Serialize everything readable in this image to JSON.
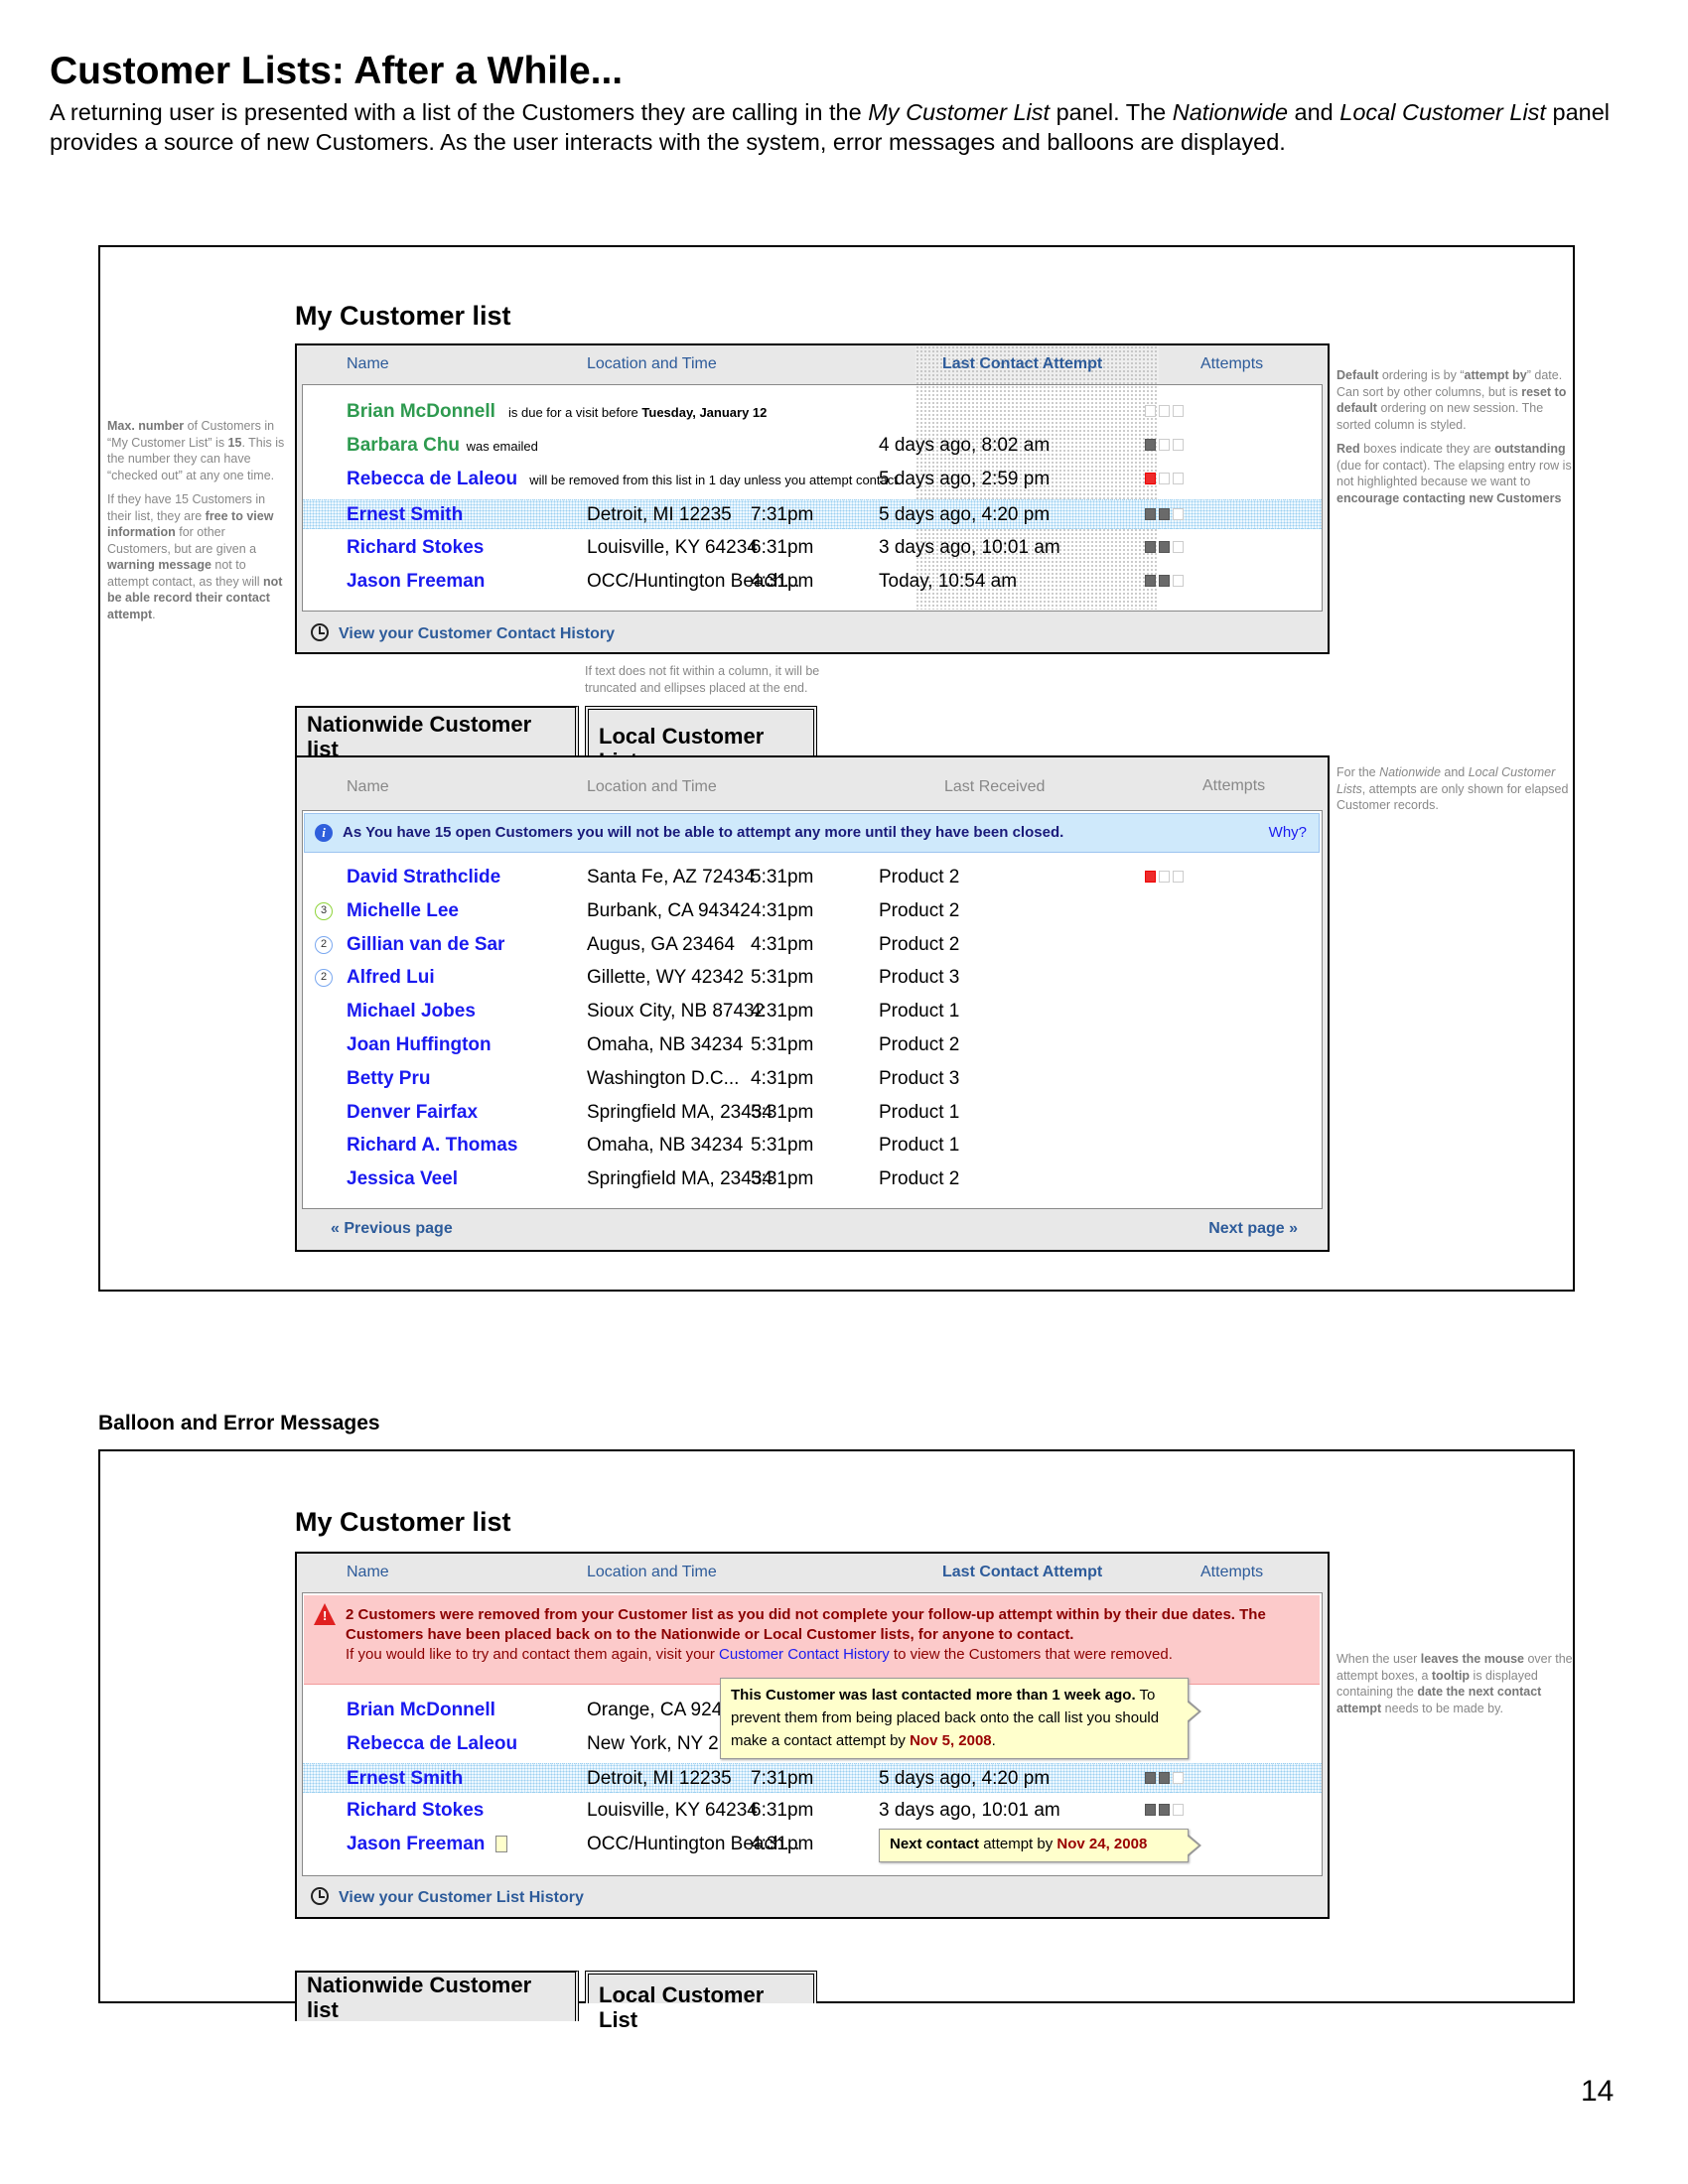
{
  "page": {
    "title": "Customer Lists: After a While...",
    "description_html": "A returning user is presented with a list of the Customers they are calling in the <i>My Customer List</i> panel. The <i>Nationwide</i> and <i>Local Customer List</i> panel provides a source of new Customers. As the user interacts with the system, error messages and balloons are displayed.",
    "section2_title": "Balloon and Error Messages",
    "page_number": "14"
  },
  "colors": {
    "link_blue": "#1a1af0",
    "header_blue": "#2d5b9a",
    "green": "#2e9a4f",
    "red_box": "#ee2b2b",
    "done_box": "#6a6a6a",
    "info_bg": "#cfe9fb",
    "error_bg": "#fccaca",
    "tooltip_bg": "#ffffcc"
  },
  "my_list": {
    "heading": "My Customer list",
    "columns": {
      "name": "Name",
      "location": "Location and Time",
      "last": "Last Contact Attempt",
      "attempts": "Attempts"
    },
    "rows": [
      {
        "name": "Brian McDonnell",
        "style": "green",
        "message_html": "is due for a visit before <b>Tuesday, January 12</b>",
        "attempts": [
          "empty",
          "empty",
          "empty"
        ]
      },
      {
        "name": "Barbara Chu",
        "style": "green",
        "message_html": "was emailed",
        "last": "4 days ago, 8:02 am",
        "attempts": [
          "done",
          "empty",
          "empty"
        ]
      },
      {
        "name": "Rebecca de Laleou",
        "style": "blue",
        "message_html": "will be removed from this list in 1 day unless you attempt contact",
        "last": "5 days ago, 2:59 pm",
        "attempts": [
          "due",
          "empty",
          "empty"
        ]
      },
      {
        "name": "Ernest Smith",
        "style": "blue",
        "highlight": true,
        "location": "Detroit, MI 12235",
        "time": "7:31pm",
        "last": "5 days ago, 4:20 pm",
        "attempts": [
          "done",
          "done",
          "empty"
        ]
      },
      {
        "name": "Richard Stokes",
        "style": "blue",
        "location": "Louisville, KY 64234",
        "time": "6:31pm",
        "last": "3 days ago, 10:01 am",
        "attempts": [
          "done",
          "done",
          "empty"
        ]
      },
      {
        "name": "Jason Freeman",
        "style": "blue",
        "location": "OCC/Huntington Beach...",
        "time": "4:31pm",
        "last": "Today, 10:54 am",
        "attempts": [
          "done",
          "done",
          "empty"
        ]
      }
    ],
    "footer_link": "View your Customer Contact History",
    "footer_icon": "clock-icon"
  },
  "notes": {
    "left_html": "<p><b>Max. number</b> of Customers in “My Customer List” is <b>15</b>. This is the number they can have “checked out” at any one time.</p><p style='margin-top:8px'>If they have 15 Customers in their list, they are <b>free to view information</b> for other Customers, but are given a <b>warning message</b> not to attempt contact, as they will <b>not be able record their contact attempt</b>.</p>",
    "right1_html": "<p><b>Default</b> ordering is by “<b>attempt by</b>” date. Can sort by other columns, but is <b>reset to default</b> ordering on new session. The sorted column is styled.</p><p style='margin-top:8px'><b>Red</b> boxes indicate they are <b>outstanding</b> (due for contact). The elapsing entry row is not highlighted because we want to <b>encourage contacting new Customers</b></p>",
    "truncate": "If text does not fit within a column, it will be truncated and ellipses placed at the end.",
    "right2_html": "For the <i>Nationwide</i> and <i>Local Customer Lists</i>, attempts are only shown for elapsed Customer records.",
    "right3_html": "When the user <b>leaves the mouse</b> over the attempt boxes, a <b>tooltip</b> is displayed containing the <b>date the next contact attempt</b> needs to be made by."
  },
  "tabs": {
    "nationwide": "Nationwide Customer list",
    "local": "Local Customer List"
  },
  "nationwide": {
    "columns": {
      "name": "Name",
      "location": "Location and Time",
      "last": "Last Received",
      "attempts": "Attempts"
    },
    "info_message": "As You have 15 open Customers you will not be able to attempt any more until they have been closed.",
    "info_link": "Why?",
    "info_icon": "info-icon",
    "rows": [
      {
        "name": "David Strathclide",
        "location": "Santa Fe, AZ 72434",
        "time": "5:31pm",
        "product": "Product 2",
        "attempts": [
          "due",
          "empty",
          "empty"
        ]
      },
      {
        "name": "Michelle Lee",
        "badge": "3",
        "badge_style": "green",
        "location": "Burbank, CA 94342",
        "time": "4:31pm",
        "product": "Product 2"
      },
      {
        "name": "Gillian van de Sar",
        "badge": "2",
        "location": "Augus, GA 23464",
        "time": "4:31pm",
        "product": "Product 2"
      },
      {
        "name": "Alfred Lui",
        "badge": "2",
        "location": "Gillette, WY 42342",
        "time": "5:31pm",
        "product": "Product 3"
      },
      {
        "name": "Michael Jobes",
        "location": "Sioux City, NB 87432",
        "time": "4:31pm",
        "product": "Product 1"
      },
      {
        "name": "Joan Huffington",
        "location": "Omaha, NB 34234",
        "time": "5:31pm",
        "product": "Product 2"
      },
      {
        "name": "Betty Pru",
        "location": "Washington D.C...",
        "time": "4:31pm",
        "product": "Product 3"
      },
      {
        "name": "Denver Fairfax",
        "location": "Springfield MA, 23434",
        "time": "5:31pm",
        "product": "Product 1"
      },
      {
        "name": "Richard A. Thomas",
        "location": "Omaha, NB 34234",
        "time": "5:31pm",
        "product": "Product 1"
      },
      {
        "name": "Jessica Veel",
        "location": "Springfield MA, 23434",
        "time": "5:31pm",
        "product": "Product 2"
      }
    ],
    "prev": "« Previous page",
    "next": "Next page »"
  },
  "my_list_2": {
    "heading": "My Customer list",
    "columns": {
      "name": "Name",
      "location": "Location and Time",
      "last": "Last Contact Attempt",
      "attempts": "Attempts"
    },
    "error_icon": "warning-icon",
    "error_bold": "2 Customers were removed from your Customer list as you did not complete your follow-up attempt within by their due dates. The Customers have been placed back on to the Nationwide or Local Customer lists, for anyone to contact.",
    "error_pre": "If you would like to try and contact them again, visit your ",
    "error_link": "Customer Contact History",
    "error_post": " to view  the Customers that were removed.",
    "rows": [
      {
        "name": "Brian McDonnell",
        "location": "Orange, CA 924",
        "attempts": [
          "due",
          "empty",
          "empty"
        ]
      },
      {
        "name": "Rebecca de Laleou",
        "location": "New York, NY 2",
        "attempts": [
          "done",
          "empty",
          "empty"
        ]
      },
      {
        "name": "Ernest Smith",
        "highlight": true,
        "location": "Detroit, MI 12235",
        "time": "7:31pm",
        "last": "5 days ago, 4:20 pm",
        "attempts": [
          "done",
          "done",
          "empty"
        ]
      },
      {
        "name": "Richard Stokes",
        "location": "Louisville, KY 64234",
        "time": "6:31pm",
        "last": "3 days ago, 10:01 am",
        "attempts": [
          "done",
          "done",
          "empty"
        ]
      },
      {
        "name": "Jason Freeman",
        "note_icon": "note-icon",
        "location": "OCC/Huntington Beach...",
        "time": "4:31pm",
        "attempts": [
          "done",
          "done",
          "empty"
        ]
      }
    ],
    "tooltip1": {
      "bold": "This Customer was last contacted more than 1 week ago.",
      "text": " To prevent them from being placed back onto the call list you should make a contact attempt by ",
      "date": "Nov 5, 2008",
      "end": "."
    },
    "tooltip2": {
      "bold": "Next contact",
      "text": " attempt by ",
      "date": "Nov 24, 2008"
    },
    "footer_link": "View your Customer List History",
    "footer_icon": "clock-icon"
  }
}
